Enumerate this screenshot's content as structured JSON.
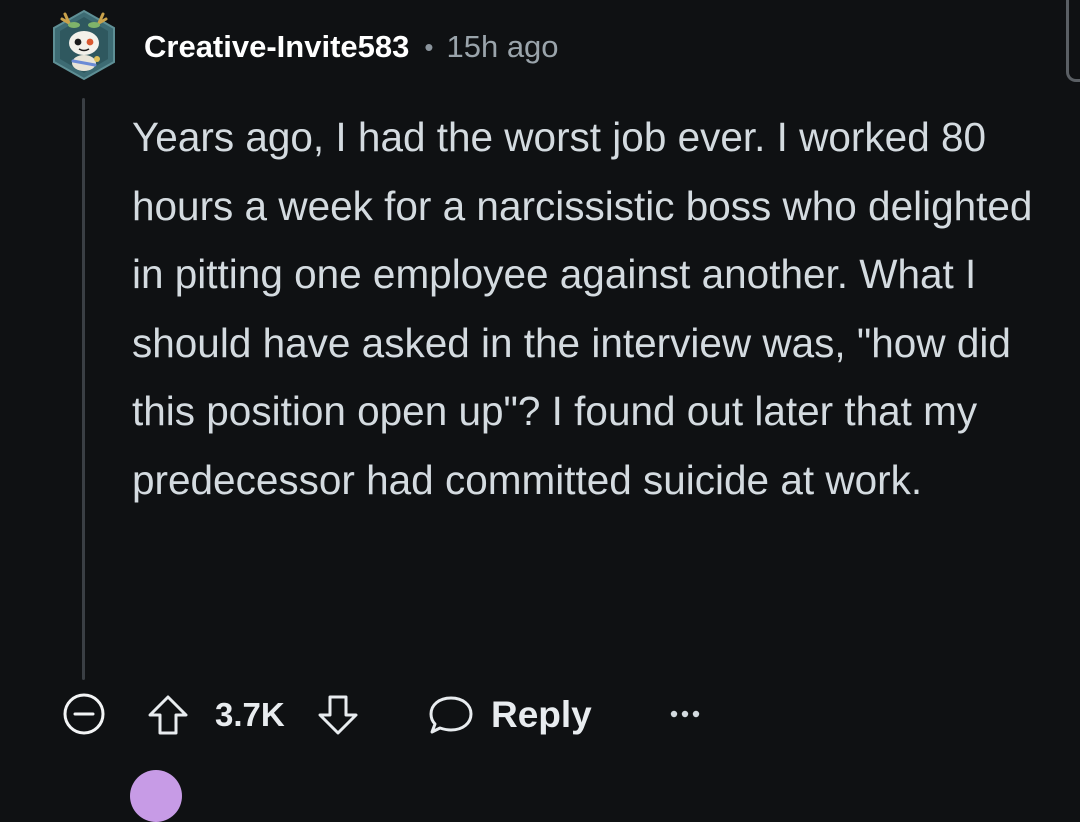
{
  "comment": {
    "username": "Creative-Invite583",
    "separator": "•",
    "time_ago": "15h ago",
    "avatar_icon": "snoo-avatar-icon",
    "body": "Years ago, I had the worst job ever. I worked 80 hours a week for a narcissistic boss who delighted in pitting one employee against another. What I should have asked in the interview was, \"how did this position open up\"? I found out later that my predecessor had committed suicide at work.",
    "actions": {
      "collapse_icon": "collapse-minus-icon",
      "upvote_icon": "upvote-arrow-icon",
      "score": "3.7K",
      "downvote_icon": "downvote-arrow-icon",
      "reply_icon": "speech-bubble-icon",
      "reply_label": "Reply",
      "more_icon": "more-options-icon"
    }
  },
  "colors": {
    "background": "#0f1113",
    "text": "#d4dbe0",
    "username": "#ffffff",
    "muted": "#9aa4ab",
    "thread_line": "#3a3f44",
    "next_avatar": "#c79be6"
  }
}
